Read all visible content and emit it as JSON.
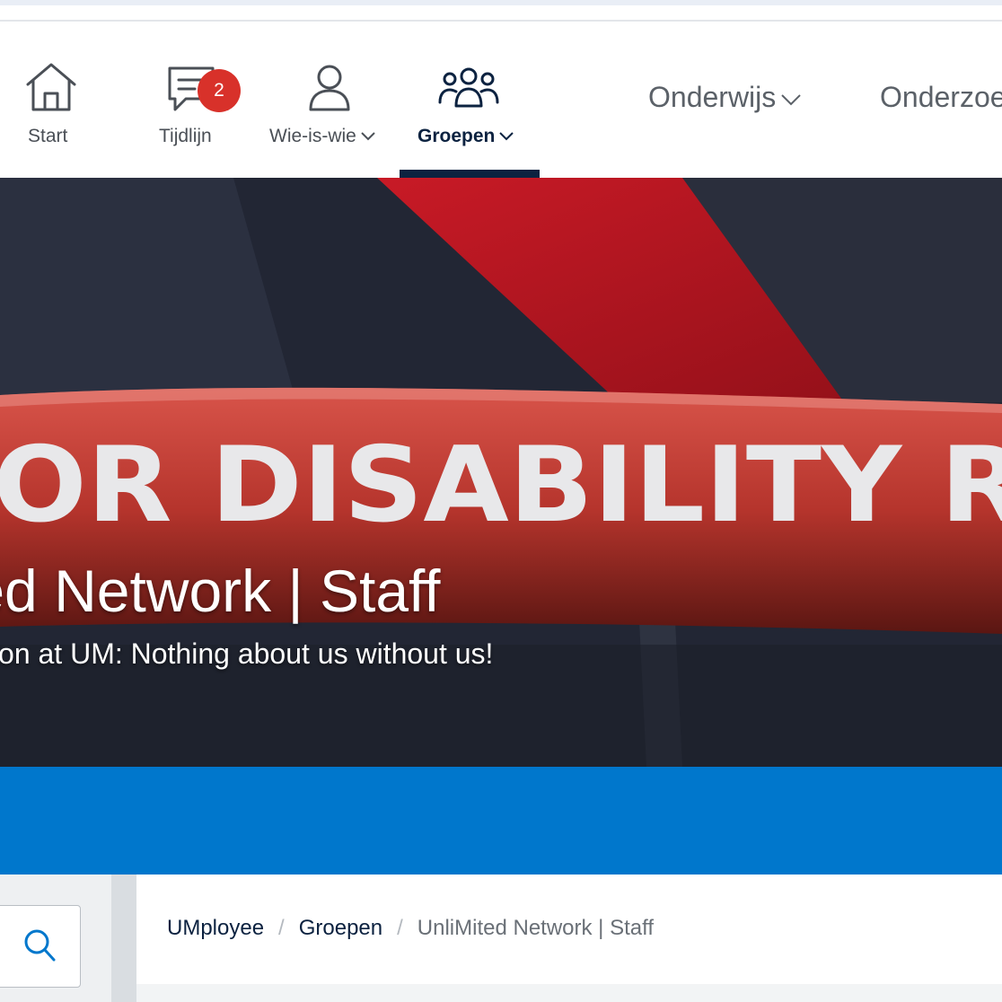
{
  "nav": {
    "items": [
      {
        "label": "Start",
        "icon": "home-icon"
      },
      {
        "label": "Tijdlijn",
        "icon": "chat-icon",
        "badge": "2"
      },
      {
        "label": "Wie-is-wie",
        "icon": "person-icon"
      },
      {
        "label": "Groepen",
        "icon": "groups-icon",
        "active": true
      }
    ],
    "menu": [
      "Onderwijs",
      "Onderzoe"
    ]
  },
  "hero": {
    "banner_text": "OR DISABILITY R",
    "title": "ted Network | Staff",
    "subtitle": "lusion at UM: Nothing about us without us!"
  },
  "breadcrumb": {
    "items": [
      "UMployee",
      "Groepen",
      "UnliMited Network | Staff"
    ],
    "separator": "/"
  },
  "colors": {
    "navy": "#0c2240",
    "badge_red": "#d8312a",
    "band_blue": "#0077cc"
  }
}
